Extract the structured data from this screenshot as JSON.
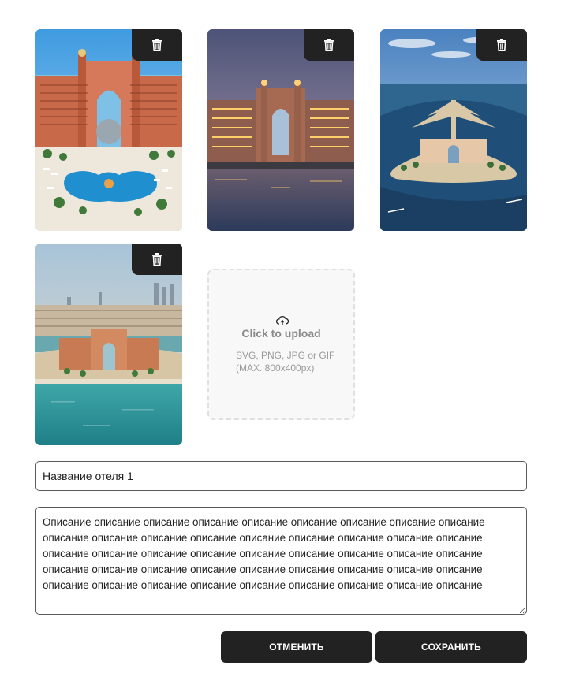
{
  "gallery": {
    "photos": [
      {
        "alt": "Atlantis hotel with pool",
        "delete_icon": "trash-icon"
      },
      {
        "alt": "Atlantis hotel at dusk",
        "delete_icon": "trash-icon"
      },
      {
        "alt": "Palm island aerial view",
        "delete_icon": "trash-icon"
      },
      {
        "alt": "Atlantis hotel aerial with city",
        "delete_icon": "trash-icon"
      }
    ],
    "upload": {
      "icon": "cloud-upload-icon",
      "title": "Click to upload",
      "hint": "SVG, PNG, JPG or GIF (MAX. 800x400px)"
    }
  },
  "form": {
    "hotel_name_value": "Название отеля 1",
    "description_value": "Описание описание описание описание описание описание описание описание описание описание описание описание описание описание описание описание описание описание описание описание описание описание описание описание описание описание описание описание описание описание описание описание описание описание описание описание описание описание описание описание описание описание описание описание описание"
  },
  "actions": {
    "cancel_label": "ОТМЕНИТЬ",
    "save_label": "СОХРАНИТЬ"
  },
  "colors": {
    "button_bg": "#222222",
    "button_text": "#ffffff",
    "upload_bg": "#f8f8f8"
  }
}
